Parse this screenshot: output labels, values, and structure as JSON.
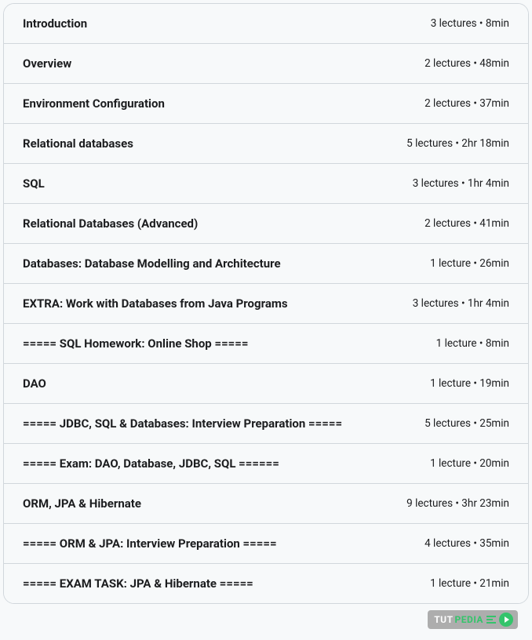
{
  "sections": [
    {
      "title": "Introduction",
      "meta": "3 lectures • 8min"
    },
    {
      "title": "Overview",
      "meta": "2 lectures • 48min"
    },
    {
      "title": "Environment Configuration",
      "meta": "2 lectures • 37min"
    },
    {
      "title": "Relational databases",
      "meta": "5 lectures • 2hr 18min"
    },
    {
      "title": "SQL",
      "meta": "3 lectures • 1hr 4min"
    },
    {
      "title": "Relational Databases (Advanced)",
      "meta": "2 lectures • 41min"
    },
    {
      "title": "Databases: Database Modelling and Architecture",
      "meta": "1 lecture • 26min"
    },
    {
      "title": "EXTRA: Work with Databases from Java Programs",
      "meta": "3 lectures • 1hr 4min"
    },
    {
      "title": "===== SQL Homework: Online Shop =====",
      "meta": "1 lecture • 8min"
    },
    {
      "title": "DAO",
      "meta": "1 lecture • 19min"
    },
    {
      "title": "===== JDBC, SQL & Databases: Interview Preparation =====",
      "meta": "5 lectures • 25min"
    },
    {
      "title": "===== Exam: DAO, Database, JDBC, SQL ======",
      "meta": "1 lecture • 20min"
    },
    {
      "title": "ORM, JPA & Hibernate",
      "meta": "9 lectures • 3hr 23min"
    },
    {
      "title": "===== ORM & JPA: Interview Preparation =====",
      "meta": "4 lectures • 35min"
    },
    {
      "title": "===== EXAM TASK: JPA & Hibernate =====",
      "meta": "1 lecture • 21min"
    }
  ],
  "watermark": {
    "tut": "TUT",
    "pedia": "PEDIA"
  }
}
